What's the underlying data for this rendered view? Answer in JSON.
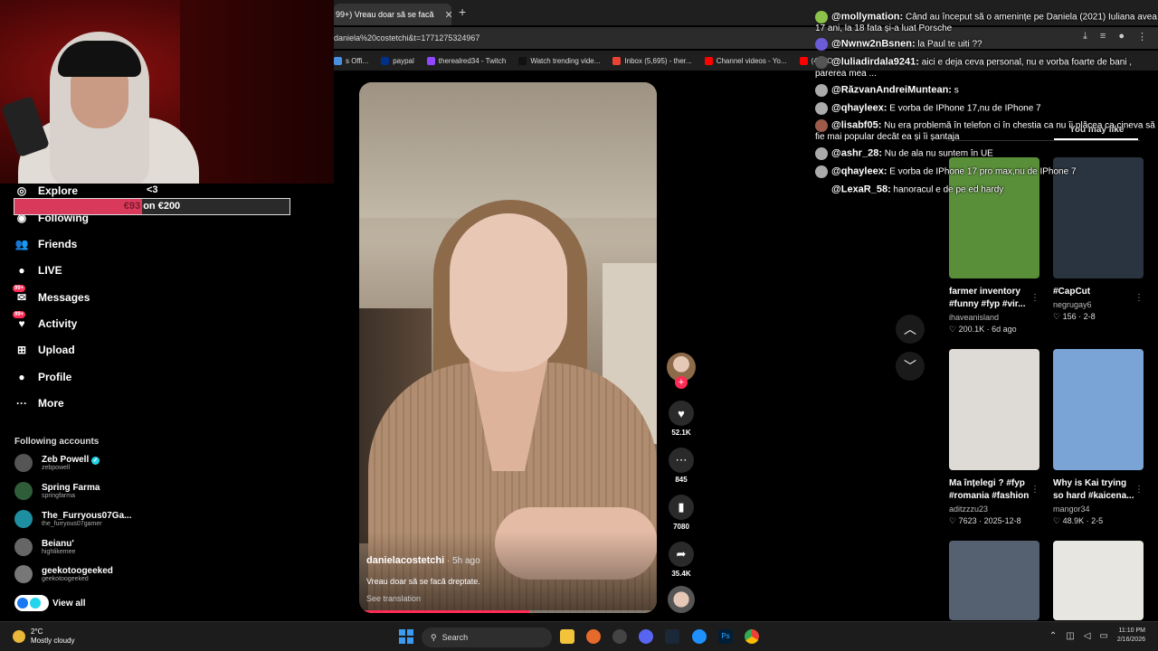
{
  "browser": {
    "tab_title": "99+) Vreau doar să se facă",
    "url": "daniela%20costetchi&t=1771275324967",
    "bookmarks": [
      {
        "label": "s Offi...",
        "color": "#4a90e2"
      },
      {
        "label": "paypal",
        "color": "#003087"
      },
      {
        "label": "therealred34 - Twitch",
        "color": "#9146ff"
      },
      {
        "label": "Watch trending vide...",
        "color": "#111111"
      },
      {
        "label": "Inbox (5,695) - ther...",
        "color": "#ea4335"
      },
      {
        "label": "Channel videos - Yo...",
        "color": "#ff0000"
      },
      {
        "label": "(4) HO",
        "color": "#ff0000"
      }
    ]
  },
  "sidebar": {
    "nav": [
      {
        "label": "Explore",
        "icon": "compass-icon",
        "glyph": "◎"
      },
      {
        "label": "Following",
        "icon": "following-icon",
        "glyph": "◉"
      },
      {
        "label": "Friends",
        "icon": "friends-icon",
        "glyph": "👥"
      },
      {
        "label": "LIVE",
        "icon": "live-icon",
        "glyph": "●"
      },
      {
        "label": "Messages",
        "icon": "messages-icon",
        "glyph": "✉",
        "badge": "99+"
      },
      {
        "label": "Activity",
        "icon": "activity-icon",
        "glyph": "♥",
        "badge": "99+"
      },
      {
        "label": "Upload",
        "icon": "upload-icon",
        "glyph": "⊞"
      },
      {
        "label": "Profile",
        "icon": "profile-icon",
        "glyph": "●"
      },
      {
        "label": "More",
        "icon": "more-icon",
        "glyph": "···"
      }
    ],
    "explore_extra": "<3",
    "donation": {
      "amount": "€93",
      "goal_text": " on €200",
      "progress": 0.465
    },
    "following_title": "Following accounts",
    "accounts": [
      {
        "name": "Zeb Powell",
        "username": "zebpowell",
        "verified": true
      },
      {
        "name": "Spring Farma",
        "username": "springfarma"
      },
      {
        "name": "The_Furryous07Ga...",
        "username": "the_furryous07gamer"
      },
      {
        "name": "Beianu'",
        "username": "highlikemee"
      },
      {
        "name": "geekotoogeeked",
        "username": "geekotoogeeked"
      }
    ],
    "view_all": "View all"
  },
  "video": {
    "author": "danielacostetchi",
    "time_ago": " · 5h ago",
    "caption": "Vreau doar să se facă dreptate.",
    "see_translation": "See translation",
    "progress": 0.57,
    "likes": "52.1K",
    "comments": "845",
    "saves": "7080",
    "shares": "35.4K"
  },
  "chat": [
    {
      "user": "@mollymation:",
      "text": " Când au început să o amenințe pe Daniela (2021) Iuliana avea 17 ani, la 18 fata și-a luat Porsche"
    },
    {
      "user": "@Nwnw2nBsnen:",
      "text": " la Paul te uiti ??"
    },
    {
      "user": "@luliadirdala9241:",
      "text": " aici e deja ceva personal, nu e vorba foarte de bani , parerea mea ..."
    },
    {
      "user": "@RăzvanAndreiMuntean:",
      "text": " s"
    },
    {
      "user": "@qhayleex:",
      "text": " E vorba de IPhone 17,nu de IPhone 7"
    },
    {
      "user": "@lisabf05:",
      "text": " Nu era problemă în telefon ci în chestia ca nu îi plăcea ca cineva să fie mai popular decât ea și îi șantaja"
    },
    {
      "user": "@ashr_28:",
      "text": " Nu de ala nu suntem în UE"
    },
    {
      "user": "@qhayleex:",
      "text": " E vorba de IPhone 17 pro max,nu de IPhone 7"
    },
    {
      "user": "@LexaR_58:",
      "text": " hanoracul e de pe ed hardy"
    }
  ],
  "recommendations": {
    "tab_label": "You may like",
    "items": [
      {
        "title": "farmer inventory #funny #fyp #vir...",
        "author": "ihaveanisland",
        "likes": "200.1K",
        "date": "6d ago",
        "thumb": "#5a8f3a"
      },
      {
        "title": "#CapCut",
        "author": "negrugay6",
        "likes": "156",
        "date": "2-8",
        "thumb": "#2a3440"
      },
      {
        "title": "Ma înțelegi ? #fyp #romania #fashion",
        "author": "aditzzzu23",
        "likes": "7623",
        "date": "2025-12-8",
        "thumb": "#dedad5"
      },
      {
        "title": "Why is Kai trying so hard #kaicena...",
        "author": "mangor34",
        "likes": "48.9K",
        "date": "2-5",
        "thumb": "#7aa4d6"
      },
      {
        "title": "",
        "author": "",
        "likes": "",
        "date": "",
        "thumb": "#556070"
      },
      {
        "title": "",
        "author": "",
        "likes": "",
        "date": "",
        "thumb": "#e8e6e0"
      }
    ]
  },
  "taskbar": {
    "temp": "2°C",
    "weather": "Mostly cloudy",
    "search": "Search",
    "time": "11:10 PM",
    "date": "2/16/2026"
  }
}
